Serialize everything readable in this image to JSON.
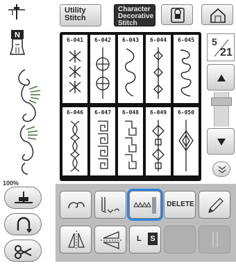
{
  "header": {
    "tab_utility": [
      "Utility",
      "Stitch"
    ],
    "tab_character": [
      "Character",
      "Decorative",
      "Stitch"
    ]
  },
  "icons": {
    "needle": "needle-position-icon",
    "foot": "presser-foot-N-icon",
    "lock": "lock-icon",
    "home": "home-icon",
    "scroll_up": "triangle-up-icon",
    "scroll_down": "triangle-down-icon",
    "more": "double-chevron-down-icon",
    "needle_down": "needle-stop-down-icon",
    "thread_cutter": "thread-cutter-icon",
    "scissors": "scissors-icon",
    "single_stitch": "single-stitch-icon",
    "bulk_stitch": "stitch-combination-icon",
    "stitch_density": "stitch-density-icon",
    "edit": "pencil-icon",
    "mirror": "mirror-vertical-icon",
    "mirror_h": "mirror-horizontal-icon",
    "twin_needle": "twin-needle-icon"
  },
  "foot_code": "N",
  "preview": {
    "zoom": "100%"
  },
  "stitches": {
    "row1": [
      {
        "code": "6-041",
        "pattern": "snowflake"
      },
      {
        "code": "6-042",
        "pattern": "circle-cross"
      },
      {
        "code": "6-043",
        "pattern": "scroll"
      },
      {
        "code": "6-044",
        "pattern": "diamond-vine"
      },
      {
        "code": "6-045",
        "pattern": "swirl"
      }
    ],
    "row2": [
      {
        "code": "6-046",
        "pattern": "braid"
      },
      {
        "code": "6-047",
        "pattern": "greek-key"
      },
      {
        "code": "6-048",
        "pattern": "block-key"
      },
      {
        "code": "6-049",
        "pattern": "knot-chain"
      },
      {
        "code": "6-050",
        "pattern": "diamond-loops"
      }
    ]
  },
  "pagination": {
    "current": "5",
    "total": "21"
  },
  "panel": {
    "delete_label": "DELETE",
    "ls_left": "L",
    "ls_right": "S"
  },
  "colors": {
    "selected_outline": "#2a86e0",
    "panel_bg": "#bdbdbd",
    "grid_border": "#111111"
  }
}
